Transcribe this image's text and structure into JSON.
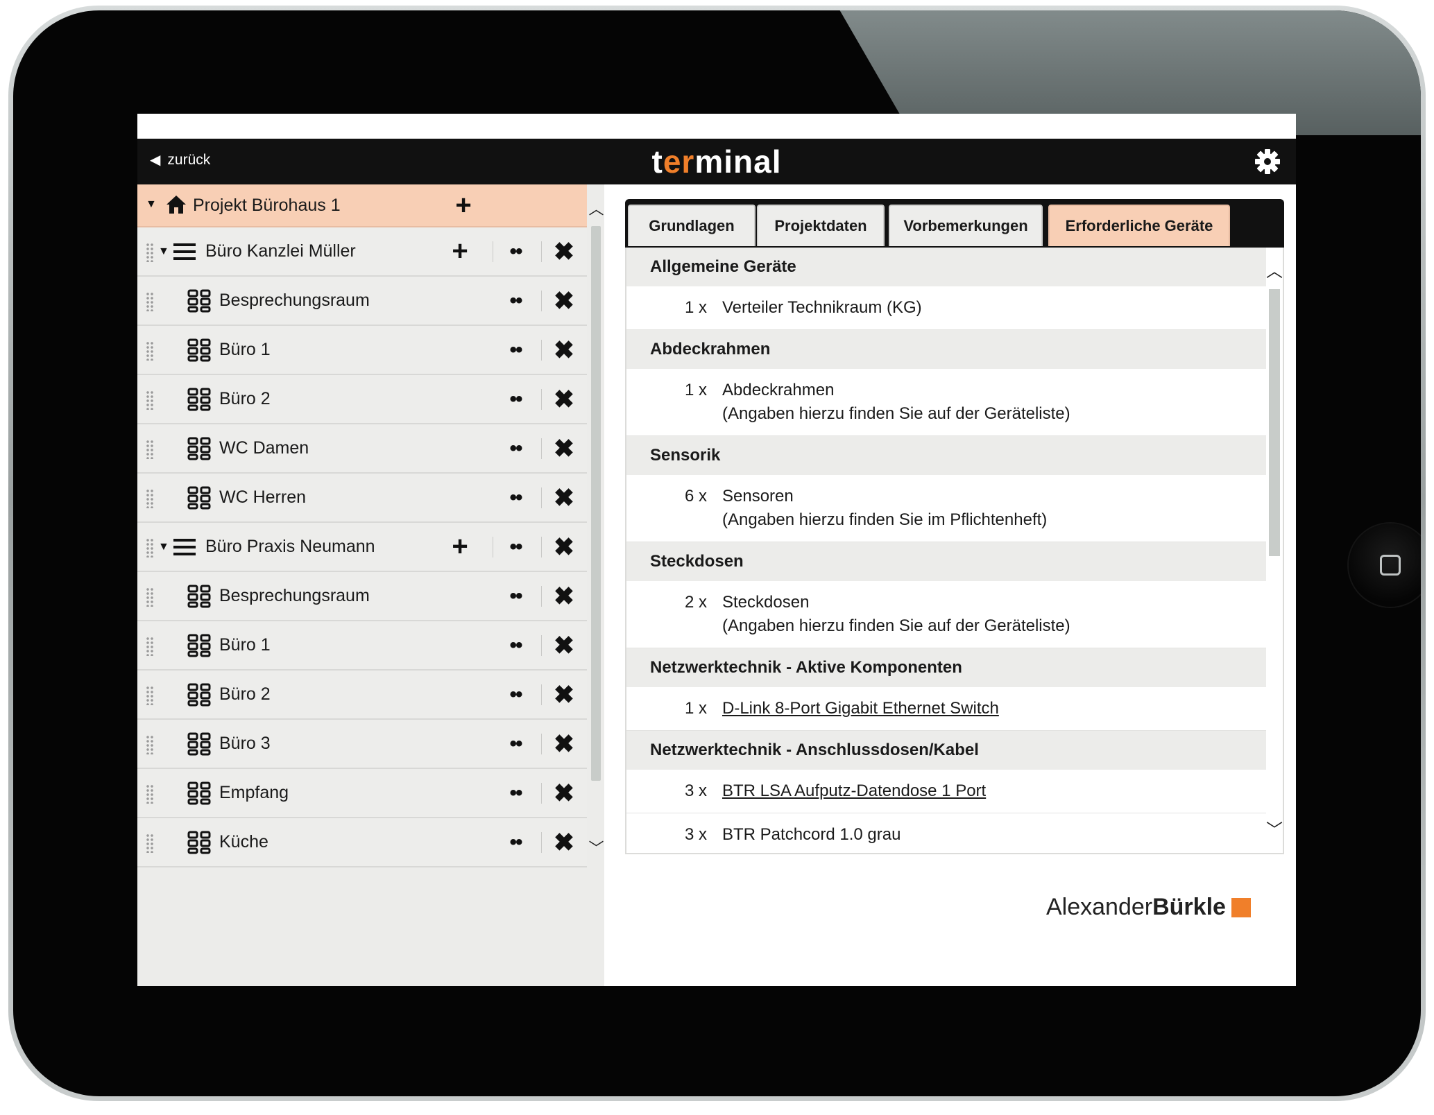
{
  "status_bar": {
    "device": "iPad"
  },
  "nav": {
    "back_label": "zurück",
    "title_pre": "t",
    "title_accent": "er",
    "title_post": "minal"
  },
  "tree": {
    "root": {
      "label": "Projekt Bürohaus 1"
    },
    "rows": [
      {
        "type": "group",
        "label": "Büro Kanzlei Müller"
      },
      {
        "type": "room",
        "label": "Besprechungsraum"
      },
      {
        "type": "room",
        "label": "Büro 1"
      },
      {
        "type": "room",
        "label": "Büro 2"
      },
      {
        "type": "room",
        "label": "WC Damen"
      },
      {
        "type": "room",
        "label": "WC Herren"
      },
      {
        "type": "group",
        "label": "Büro Praxis Neumann"
      },
      {
        "type": "room",
        "label": "Besprechungsraum"
      },
      {
        "type": "room",
        "label": "Büro 1"
      },
      {
        "type": "room",
        "label": "Büro 2"
      },
      {
        "type": "room",
        "label": "Büro 3"
      },
      {
        "type": "room",
        "label": "Empfang"
      },
      {
        "type": "room",
        "label": "Küche"
      }
    ],
    "actions": {
      "add": "+",
      "more": "••",
      "delete": "✖"
    }
  },
  "tabs": [
    {
      "label": "Grundlagen"
    },
    {
      "label": "Projektdaten"
    },
    {
      "label": "Vorbemerkungen"
    },
    {
      "label": "Erforderliche Geräte",
      "active": true
    }
  ],
  "sections": [
    {
      "title": "Allgemeine Geräte",
      "items": [
        {
          "qty": "1 x",
          "lines": [
            "Verteiler Technikraum (KG)"
          ]
        }
      ]
    },
    {
      "title": "Abdeckrahmen",
      "items": [
        {
          "qty": "1 x",
          "lines": [
            "Abdeckrahmen",
            "(Angaben hierzu finden Sie auf der Geräteliste)"
          ]
        }
      ]
    },
    {
      "title": "Sensorik",
      "items": [
        {
          "qty": "6 x",
          "lines": [
            "Sensoren",
            "(Angaben hierzu finden Sie im Pflichtenheft)"
          ]
        }
      ]
    },
    {
      "title": "Steckdosen",
      "items": [
        {
          "qty": "2 x",
          "lines": [
            "Steckdosen",
            "(Angaben hierzu finden Sie auf der Geräteliste)"
          ]
        }
      ]
    },
    {
      "title": "Netzwerktechnik - Aktive Komponenten",
      "items": [
        {
          "qty": "1 x",
          "lines": [
            "D-Link 8-Port Gigabit Ethernet Switch"
          ],
          "link": true
        }
      ]
    },
    {
      "title": "Netzwerktechnik - Anschlussdosen/Kabel",
      "items": [
        {
          "qty": "3 x",
          "lines": [
            "BTR LSA Aufputz-Datendose 1 Port"
          ],
          "link": true
        },
        {
          "qty": "3 x",
          "lines": [
            "BTR Patchcord 1.0 grau"
          ]
        }
      ]
    }
  ],
  "logo": {
    "regular": "Alexander",
    "bold": "Bürkle"
  },
  "colors": {
    "accent": "#f07f2a",
    "highlight": "#f8cfb5",
    "navbar": "#111111"
  }
}
